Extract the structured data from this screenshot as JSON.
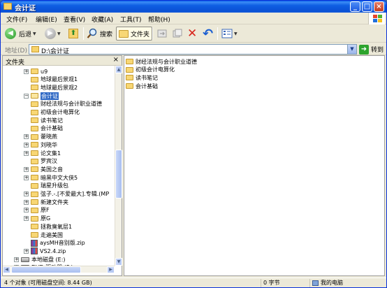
{
  "window": {
    "title": "会计证",
    "controls": {
      "minimize": "_",
      "maximize": "□",
      "close": "×"
    }
  },
  "menu": {
    "items": [
      {
        "label": "文件(F)"
      },
      {
        "label": "编辑(E)"
      },
      {
        "label": "查看(V)"
      },
      {
        "label": "收藏(A)"
      },
      {
        "label": "工具(T)"
      },
      {
        "label": "帮助(H)"
      }
    ]
  },
  "toolbar": {
    "back_label": "后退",
    "back_icon": "◀",
    "forward_icon": "▶",
    "up_icon": "⬆",
    "search_label": "搜索",
    "folders_label": "文件夹",
    "delete_icon": "✕",
    "undo_icon": "↶"
  },
  "address": {
    "label": "地址(D)",
    "value": "D:\\会计证",
    "go_label": "转到",
    "go_icon": "➜"
  },
  "folder_pane": {
    "title": "文件夹",
    "close": "×",
    "tree": [
      {
        "label": "u9",
        "expander": "+",
        "icon": "folder",
        "level": 1
      },
      {
        "label": "地球最后景观1",
        "expander": "",
        "icon": "folder",
        "level": 1
      },
      {
        "label": "地球最后景观2",
        "expander": "",
        "icon": "folder",
        "level": 1
      },
      {
        "label": "会计证",
        "expander": "−",
        "icon": "folder-open",
        "level": 1,
        "selected": true
      },
      {
        "label": "财经法规与会计职业道德",
        "expander": "",
        "icon": "folder",
        "level": 2
      },
      {
        "label": "初级会计电算化",
        "expander": "",
        "icon": "folder",
        "level": 2
      },
      {
        "label": "读书笔记",
        "expander": "",
        "icon": "folder",
        "level": 2
      },
      {
        "label": "会计基础",
        "expander": "",
        "icon": "folder",
        "level": 2
      },
      {
        "label": "藿晓燕",
        "expander": "+",
        "icon": "folder",
        "level": 1
      },
      {
        "label": "刘晓华",
        "expander": "+",
        "icon": "folder",
        "level": 1
      },
      {
        "label": "论文集1",
        "expander": "+",
        "icon": "folder",
        "level": 1
      },
      {
        "label": "罗宾汉",
        "expander": "",
        "icon": "folder",
        "level": 1
      },
      {
        "label": "美国之音",
        "expander": "+",
        "icon": "folder",
        "level": 1
      },
      {
        "label": "暗黑中文大侠5",
        "expander": "+",
        "icon": "folder",
        "level": 1
      },
      {
        "label": "瑞星升级包",
        "expander": "",
        "icon": "folder",
        "level": 1
      },
      {
        "label": "弦子.-.[不爱最大].专辑.(MP",
        "expander": "+",
        "icon": "folder",
        "level": 1
      },
      {
        "label": "新建文件夹",
        "expander": "+",
        "icon": "folder",
        "level": 1
      },
      {
        "label": "原F",
        "expander": "+",
        "icon": "folder",
        "level": 1
      },
      {
        "label": "原G",
        "expander": "+",
        "icon": "folder",
        "level": 1
      },
      {
        "label": "拯救臭氧层1",
        "expander": "",
        "icon": "folder",
        "level": 1
      },
      {
        "label": "走遍美国",
        "expander": "",
        "icon": "folder",
        "level": 1
      },
      {
        "label": "aysMH音别版.zip",
        "expander": "",
        "icon": "zip",
        "level": 1
      },
      {
        "label": "VS2.4.zip",
        "expander": "+",
        "icon": "zip",
        "level": 1
      },
      {
        "label": "本地磁盘 (E:)",
        "expander": "+",
        "icon": "drive",
        "level": 0
      },
      {
        "label": "DVD 驱动器 (F:)",
        "expander": "+",
        "icon": "drive",
        "level": 0
      }
    ]
  },
  "content": {
    "items": [
      {
        "label": "财经法规与会计职业道德"
      },
      {
        "label": "初级会计电算化"
      },
      {
        "label": "读书笔记"
      },
      {
        "label": "会计基础"
      }
    ]
  },
  "status": {
    "objects": "4 个对象 (可用磁盘空间: 8.44 GB)",
    "size": "0 字节",
    "location": "我的电脑"
  },
  "colors": {
    "titlebar": "#0b52d6",
    "selection": "#316ac5",
    "folder": "#f8d775"
  }
}
